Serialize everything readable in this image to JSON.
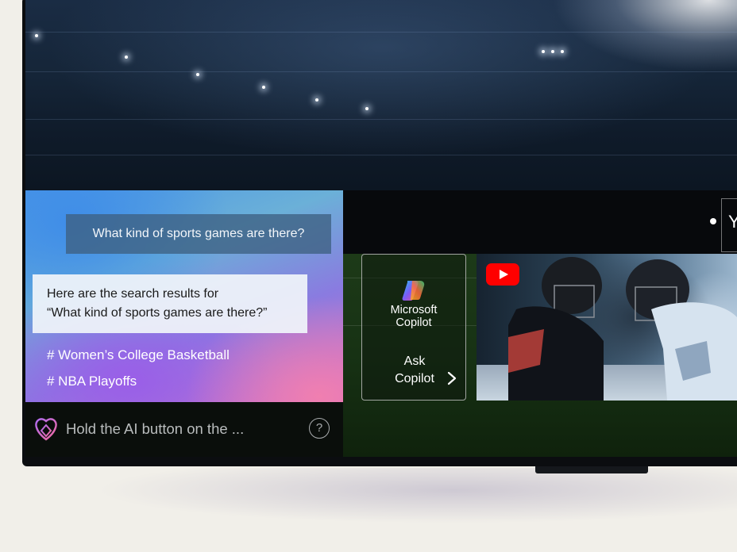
{
  "ai_panel": {
    "question": "What kind of sports games are there?",
    "answer_line1": "Here are the search results for",
    "answer_line2": "“What kind of sports games are there?”",
    "tags": [
      "# Women’s College Basketball",
      "# NBA Playoffs"
    ],
    "hint": "Hold the AI button on the ...",
    "help_icon_symbol": "?"
  },
  "copilot_card": {
    "name_line1": "Microsoft",
    "name_line2": "Copilot",
    "ask_line1": "Ask",
    "ask_line2": "Copilot",
    "icon": "copilot-logo-icon"
  },
  "content_row": {
    "tile_icon": "youtube-logo-icon",
    "partial_label": "Yo"
  },
  "colors": {
    "youtube_red": "#ff0000",
    "bezel": "#0b0d10",
    "page_background": "#f1efe9"
  }
}
